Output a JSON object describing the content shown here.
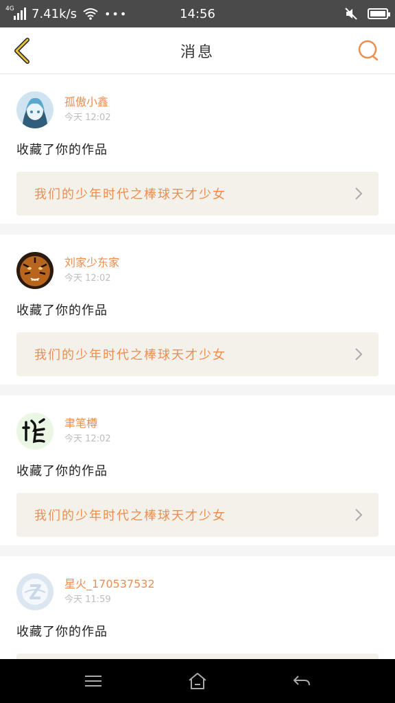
{
  "status_bar": {
    "network_tag": "4G",
    "speed": "7.41k/s",
    "more": "•••",
    "time": "14:56"
  },
  "header": {
    "title": "消息"
  },
  "colors": {
    "accent": "#f08c4e",
    "back_icon": "#e8c33a"
  },
  "notifications": [
    {
      "username": "孤傲小鑫",
      "time": "今天 12:02",
      "action": "收藏了你的作品",
      "work_title": "我们的少年时代之棒球天才少女",
      "avatar": "anime-avatar"
    },
    {
      "username": "刘家少东家",
      "time": "今天 12:02",
      "action": "收藏了你的作品",
      "work_title": "我们的少年时代之棒球天才少女",
      "avatar": "tiger-avatar"
    },
    {
      "username": "聿笔樽",
      "time": "今天 12:02",
      "action": "收藏了你的作品",
      "work_title": "我们的少年时代之棒球天才少女",
      "avatar": "calligraphy-avatar"
    },
    {
      "username": "星火_170537532",
      "time": "今天 11:59",
      "action": "收藏了你的作品",
      "work_title": "",
      "avatar": "default-avatar"
    }
  ],
  "icons": {
    "back": "chevron-left-icon",
    "search": "search-icon",
    "nav_menu": "menu-icon",
    "nav_home": "home-icon",
    "nav_back": "back-arrow-icon"
  }
}
